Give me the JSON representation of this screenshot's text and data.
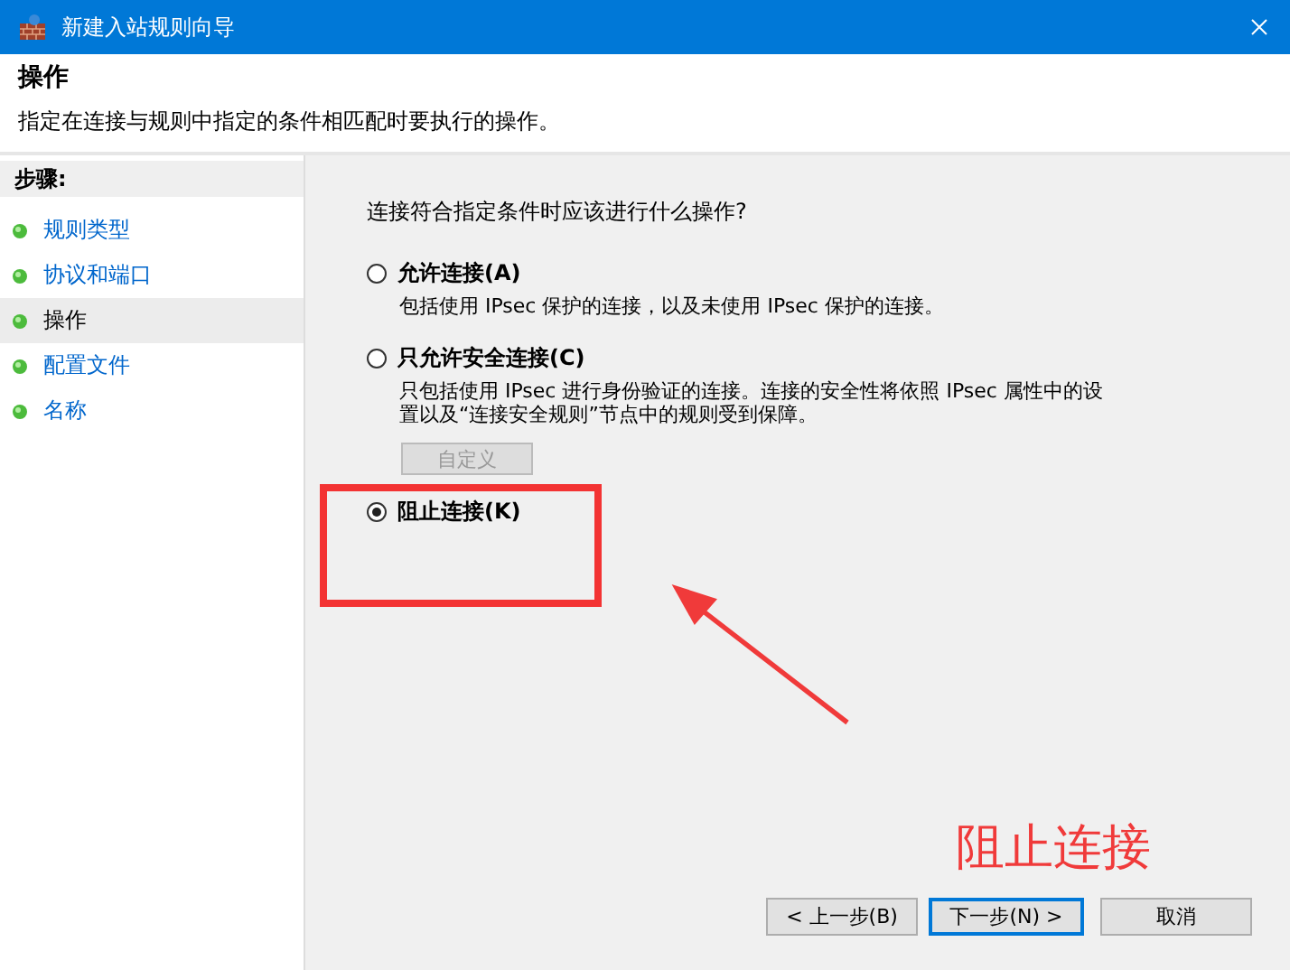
{
  "window": {
    "title": "新建入站规则向导"
  },
  "header": {
    "title": "操作",
    "description": "指定在连接与规则中指定的条件相匹配时要执行的操作。"
  },
  "steps": {
    "heading": "步骤:",
    "items": [
      {
        "label": "规则类型",
        "selected": false
      },
      {
        "label": "协议和端口",
        "selected": false
      },
      {
        "label": "操作",
        "selected": true
      },
      {
        "label": "配置文件",
        "selected": false
      },
      {
        "label": "名称",
        "selected": false
      }
    ]
  },
  "question": "连接符合指定条件时应该进行什么操作?",
  "options": [
    {
      "label": "允许连接(A)",
      "description": "包括使用 IPsec 保护的连接，以及未使用 IPsec 保护的连接。",
      "selected": false
    },
    {
      "label": "只允许安全连接(C)",
      "description": "只包括使用 IPsec 进行身份验证的连接。连接的安全性将依照 IPsec 属性中的设置以及“连接安全规则”节点中的规则受到保障。",
      "selected": false,
      "button": {
        "label": "自定义",
        "disabled": true
      }
    },
    {
      "label": "阻止连接(K)",
      "selected": true
    }
  ],
  "annotation": {
    "text": "阻止连接"
  },
  "buttons": [
    {
      "label": "< 上一步(B)",
      "default": false
    },
    {
      "label": "下一步(N) >",
      "default": true
    },
    {
      "label": "取消",
      "default": false
    }
  ]
}
